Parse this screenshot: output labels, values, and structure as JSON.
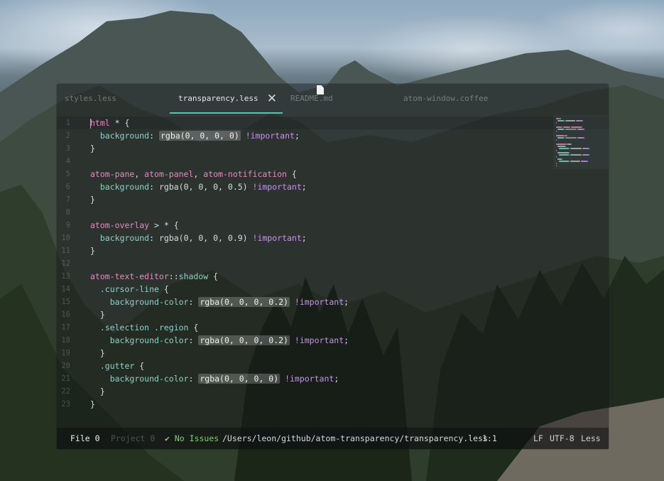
{
  "window": {
    "title": "transparency.less"
  },
  "tabs": [
    {
      "label": "styles.less",
      "active": false
    },
    {
      "label": "transparency.less",
      "active": true
    },
    {
      "label": "README.md",
      "active": false
    },
    {
      "label": "atom-window.coffee",
      "active": false
    }
  ],
  "tab_close_glyph": "✕",
  "icons": {
    "close": "close-icon",
    "file": "file-icon",
    "check": "check-icon"
  },
  "code_lines": [
    {
      "num": "1",
      "cursor": true,
      "parts": [
        [
          "sel",
          "html"
        ],
        [
          "pun",
          " * {"
        ]
      ]
    },
    {
      "num": "2",
      "parts": [
        [
          "pun",
          "  "
        ],
        [
          "prop",
          "background"
        ],
        [
          "pun",
          ": "
        ],
        [
          "val",
          "rgba(0, 0, 0, 0)"
        ],
        [
          "pun",
          " "
        ],
        [
          "imp",
          "!important"
        ],
        [
          "pun",
          ";"
        ]
      ]
    },
    {
      "num": "3",
      "parts": [
        [
          "pun",
          "}"
        ]
      ]
    },
    {
      "num": "4",
      "parts": []
    },
    {
      "num": "5",
      "parts": [
        [
          "sel",
          "atom-pane"
        ],
        [
          "pun",
          ", "
        ],
        [
          "sel",
          "atom-panel"
        ],
        [
          "pun",
          ", "
        ],
        [
          "sel",
          "atom-notification"
        ],
        [
          "pun",
          " {"
        ]
      ]
    },
    {
      "num": "6",
      "parts": [
        [
          "pun",
          "  "
        ],
        [
          "prop",
          "background"
        ],
        [
          "pun",
          ": "
        ],
        [
          "pun",
          "rgba(0, 0, 0, 0.5)"
        ],
        [
          "pun",
          " "
        ],
        [
          "imp",
          "!important"
        ],
        [
          "pun",
          ";"
        ]
      ]
    },
    {
      "num": "7",
      "parts": [
        [
          "pun",
          "}"
        ]
      ]
    },
    {
      "num": "8",
      "parts": []
    },
    {
      "num": "9",
      "parts": [
        [
          "sel",
          "atom-overlay"
        ],
        [
          "pun",
          " > * {"
        ]
      ]
    },
    {
      "num": "10",
      "parts": [
        [
          "pun",
          "  "
        ],
        [
          "prop",
          "background"
        ],
        [
          "pun",
          ": "
        ],
        [
          "pun",
          "rgba(0, 0, 0, 0.9)"
        ],
        [
          "pun",
          " "
        ],
        [
          "imp",
          "!important"
        ],
        [
          "pun",
          ";"
        ]
      ]
    },
    {
      "num": "11",
      "parts": [
        [
          "pun",
          "}"
        ]
      ]
    },
    {
      "num": "12",
      "parts": []
    },
    {
      "num": "13",
      "parts": [
        [
          "sel",
          "atom-text-editor"
        ],
        [
          "pun",
          "::"
        ],
        [
          "prop",
          "shadow"
        ],
        [
          "pun",
          " {"
        ]
      ]
    },
    {
      "num": "14",
      "parts": [
        [
          "pun",
          "  "
        ],
        [
          "prop",
          ".cursor-line"
        ],
        [
          "pun",
          " {"
        ]
      ]
    },
    {
      "num": "15",
      "parts": [
        [
          "pun",
          "    "
        ],
        [
          "prop",
          "background-color"
        ],
        [
          "pun",
          ": "
        ],
        [
          "val",
          "rgba(0, 0, 0, 0.2)"
        ],
        [
          "pun",
          " "
        ],
        [
          "imp",
          "!important"
        ],
        [
          "pun",
          ";"
        ]
      ]
    },
    {
      "num": "16",
      "parts": [
        [
          "pun",
          "  }"
        ]
      ]
    },
    {
      "num": "17",
      "parts": [
        [
          "pun",
          "  "
        ],
        [
          "prop",
          ".selection .region"
        ],
        [
          "pun",
          " {"
        ]
      ]
    },
    {
      "num": "18",
      "parts": [
        [
          "pun",
          "    "
        ],
        [
          "prop",
          "background-color"
        ],
        [
          "pun",
          ": "
        ],
        [
          "val",
          "rgba(0, 0, 0, 0.2)"
        ],
        [
          "pun",
          " "
        ],
        [
          "imp",
          "!important"
        ],
        [
          "pun",
          ";"
        ]
      ]
    },
    {
      "num": "19",
      "parts": [
        [
          "pun",
          "  }"
        ]
      ]
    },
    {
      "num": "20",
      "parts": [
        [
          "pun",
          "  "
        ],
        [
          "prop",
          ".gutter"
        ],
        [
          "pun",
          " {"
        ]
      ]
    },
    {
      "num": "21",
      "parts": [
        [
          "pun",
          "    "
        ],
        [
          "prop",
          "background-color"
        ],
        [
          "pun",
          ": "
        ],
        [
          "val",
          "rgba(0, 0, 0, 0)"
        ],
        [
          "pun",
          " "
        ],
        [
          "imp",
          "!important"
        ],
        [
          "pun",
          ";"
        ]
      ]
    },
    {
      "num": "22",
      "parts": [
        [
          "pun",
          "  }"
        ]
      ]
    },
    {
      "num": "23",
      "parts": [
        [
          "pun",
          "}"
        ]
      ]
    }
  ],
  "status_bar": {
    "file_label": "File",
    "file_count": "0",
    "project_label": "Project",
    "project_count": "0",
    "issues": "No Issues",
    "path": "/Users/leon/github/atom-transparency/transparency.less",
    "cursor_pos": "1:1",
    "line_ending": "LF",
    "encoding": "UTF-8",
    "grammar": "Less"
  },
  "colors": {
    "accent": "#58c4b0",
    "selector": "#e48ac0",
    "property": "#8fd1c8",
    "important": "#c792ea",
    "no_issues": "#78d36b"
  }
}
